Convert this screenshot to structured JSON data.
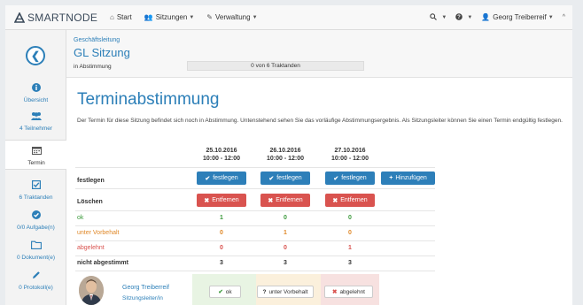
{
  "navbar": {
    "brand": "SMARTNODE",
    "items": [
      {
        "label": "Start",
        "icon": "home-icon"
      },
      {
        "label": "Sitzungen",
        "icon": "users-icon"
      },
      {
        "label": "Verwaltung",
        "icon": "wrench-icon"
      }
    ],
    "user": "Georg Treiberreif"
  },
  "sidebar": {
    "items": [
      {
        "label": "Übersicht",
        "icon": "info-icon"
      },
      {
        "label": "4 Teilnehmer",
        "icon": "users-icon"
      },
      {
        "label": "Termin",
        "icon": "calendar-icon"
      },
      {
        "label": "6 Traktanden",
        "icon": "checkbox-icon"
      },
      {
        "label": "0/0 Aufgabe(n)",
        "icon": "check-circle-icon"
      },
      {
        "label": "0 Dokument(e)",
        "icon": "folder-icon"
      },
      {
        "label": "0 Protokoll(e)",
        "icon": "pencil-icon"
      }
    ]
  },
  "header": {
    "super": "Geschäftsleitung",
    "title": "GL Sitzung",
    "status": "in Abstimmung",
    "progress": "0 von 6 Traktanden"
  },
  "main": {
    "title": "Terminabstimmung",
    "description": "Der Termin für diese Sitzung befindet sich noch in Abstimmung. Untenstehend sehen Sie das vorläufige Abstimmungsergebnis. Als Sitzungsleiter können Sie einen Termin endgültig festlegen.",
    "dates": [
      {
        "date": "25.10.2016",
        "time": "10:00 - 12:00"
      },
      {
        "date": "26.10.2016",
        "time": "10:00 - 12:00"
      },
      {
        "date": "27.10.2016",
        "time": "10:00 - 12:00"
      }
    ],
    "festlegen_label": "festlegen",
    "festlegen_button": "festlegen",
    "add_button": "Hinzufügen",
    "loeschen_label": "Löschen",
    "remove_button": "Entfernen",
    "rows": [
      {
        "label": "ok",
        "values": [
          "1",
          "0",
          "0"
        ]
      },
      {
        "label": "unter Vorbehalt",
        "values": [
          "0",
          "1",
          "0"
        ]
      },
      {
        "label": "abgelehnt",
        "values": [
          "0",
          "0",
          "1"
        ]
      },
      {
        "label": "nicht abgestimmt",
        "values": [
          "3",
          "3",
          "3"
        ]
      }
    ],
    "voter": {
      "name": "Georg Treiberreif",
      "role": "Sitzungsleiter/in",
      "votes": [
        "ok",
        "unter Vorbehalt",
        "abgelehnt"
      ]
    }
  },
  "colors": {
    "primary": "#2d7fb9",
    "danger": "#d9534f",
    "ok": "#3c9a3c",
    "warning": "#e0892a"
  }
}
